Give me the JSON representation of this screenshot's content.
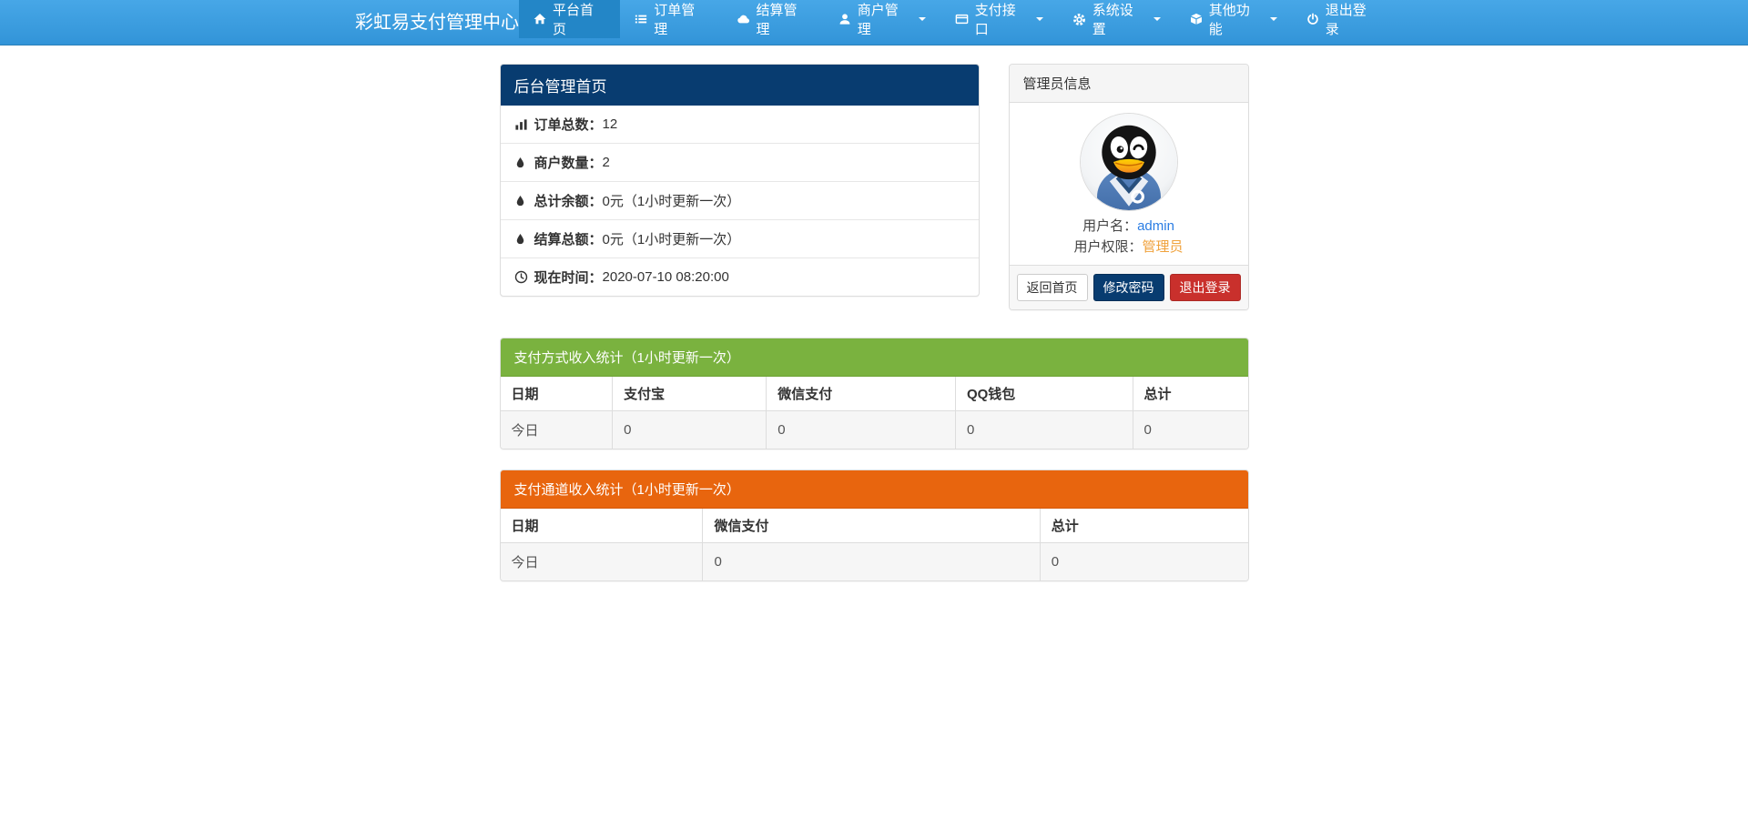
{
  "colors": {
    "navbar_blue_top": "#47a7e7",
    "navbar_blue_bottom": "#3294d8",
    "navbar_active": "#2386c7",
    "panel_navy": "#083c70",
    "table_green": "#7ab23f",
    "table_orange": "#e8650e",
    "button_red": "#c9302c",
    "username_link_blue": "#2b7de3",
    "role_link_orange": "#f0a23c"
  },
  "navbar": {
    "brand": "彩虹易支付管理中心",
    "items": [
      {
        "label": "平台首页",
        "icon": "home-icon",
        "active": true,
        "dropdown": false
      },
      {
        "label": "订单管理",
        "icon": "list-icon",
        "active": false,
        "dropdown": false
      },
      {
        "label": "结算管理",
        "icon": "cloud-icon",
        "active": false,
        "dropdown": false
      },
      {
        "label": "商户管理",
        "icon": "user-icon",
        "active": false,
        "dropdown": true
      },
      {
        "label": "支付接口",
        "icon": "credit-card-icon",
        "active": false,
        "dropdown": true
      },
      {
        "label": "系统设置",
        "icon": "gear-icon",
        "active": false,
        "dropdown": true
      },
      {
        "label": "其他功能",
        "icon": "cube-icon",
        "active": false,
        "dropdown": true
      },
      {
        "label": "退出登录",
        "icon": "power-icon",
        "active": false,
        "dropdown": false
      }
    ]
  },
  "dashboard": {
    "title": "后台管理首页",
    "stats": [
      {
        "icon": "bar-chart-icon",
        "label": "订单总数：",
        "value": "12"
      },
      {
        "icon": "droplet-icon",
        "label": "商户数量：",
        "value": "2"
      },
      {
        "icon": "droplet-icon",
        "label": "总计余额：",
        "value": "0元（1小时更新一次）"
      },
      {
        "icon": "droplet-icon",
        "label": "结算总额：",
        "value": "0元（1小时更新一次）"
      },
      {
        "icon": "clock-icon",
        "label": "现在时间：",
        "value": " 2020-07-10 08:20:00"
      }
    ]
  },
  "admin_panel": {
    "title": "管理员信息",
    "avatar": "qq-penguin-avatar",
    "username_label": "用户名：",
    "username": "admin",
    "role_label": "用户权限：",
    "role": "管理员",
    "buttons": [
      {
        "label": "返回首页",
        "style": "default"
      },
      {
        "label": "修改密码",
        "style": "primary"
      },
      {
        "label": "退出登录",
        "style": "danger"
      }
    ]
  },
  "income_by_method": {
    "title": "支付方式收入统计（1小时更新一次）",
    "columns": [
      "日期",
      "支付宝",
      "微信支付",
      "QQ钱包",
      "总计"
    ],
    "rows": [
      [
        "今日",
        "0",
        "0",
        "0",
        "0"
      ]
    ]
  },
  "income_by_channel": {
    "title": "支付通道收入统计（1小时更新一次）",
    "columns": [
      "日期",
      "微信支付",
      "总计"
    ],
    "rows": [
      [
        "今日",
        "0",
        "0"
      ]
    ]
  }
}
